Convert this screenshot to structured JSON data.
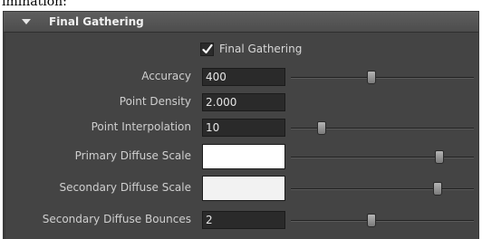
{
  "caption_text": "imination:",
  "panel": {
    "title": "Final Gathering",
    "checkbox": {
      "label": "Final Gathering",
      "checked": true
    },
    "rows": [
      {
        "id": "accuracy",
        "label": "Accuracy",
        "value": "400",
        "slider_fraction": 0.44
      },
      {
        "id": "point-density",
        "label": "Point Density",
        "value": "2.000"
      },
      {
        "id": "point-interpolation",
        "label": "Point Interpolation",
        "value": "10",
        "slider_fraction": 0.15
      },
      {
        "id": "primary-diffuse-scale",
        "label": "Primary Diffuse Scale",
        "color": "#ffffff",
        "slider_fraction": 0.83
      },
      {
        "id": "secondary-diffuse-scale",
        "label": "Secondary Diffuse Scale",
        "color": "#f2f2f2",
        "slider_fraction": 0.82
      },
      {
        "id": "secondary-diffuse-bounces",
        "label": "Secondary Diffuse Bounces",
        "value": "2",
        "slider_fraction": 0.44
      }
    ]
  },
  "colors": {
    "panel_bg": "#444444",
    "header_bg": "#555555",
    "field_bg": "#2a2a2a",
    "text": "#cfcfcf"
  },
  "icons": {
    "collapse": "triangle-down-icon",
    "check": "checkmark-icon",
    "slider": "slider-thumb-icon"
  }
}
